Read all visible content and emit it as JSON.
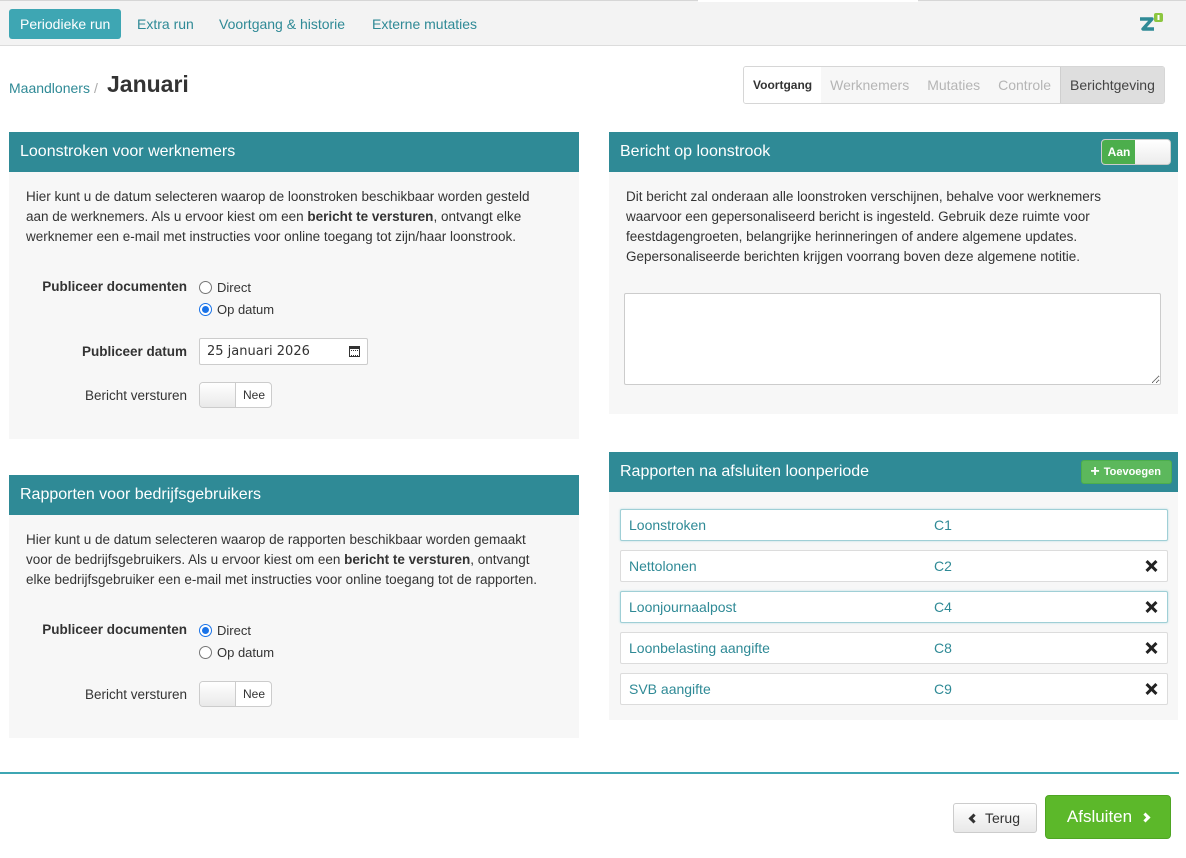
{
  "topnav": {
    "tabs": [
      "Periodieke run",
      "Extra run",
      "Voortgang & historie",
      "Externe mutaties"
    ]
  },
  "header": {
    "breadcrumb": "Maandloners",
    "breadcrumb_sep": "/",
    "title": "Januari"
  },
  "steps": [
    "Voortgang",
    "Werknemers",
    "Mutaties",
    "Controle",
    "Berichtgeving"
  ],
  "payslips_panel": {
    "title": "Loonstroken voor werknemers",
    "intro_1": "Hier kunt u de datum selecteren waarop de loonstroken beschikbaar worden gesteld",
    "intro_2a": "aan de werknemers. Als u ervoor kiest om een ",
    "intro_2b": "bericht te versturen",
    "intro_2c": ", ontvangt elke",
    "intro_3": "werknemer een e-mail met instructies voor online toegang tot zijn/haar loonstrook.",
    "publish_label": "Publiceer documenten",
    "opt_direct": "Direct",
    "opt_date": "Op datum",
    "date_label": "Publiceer datum",
    "date_value": "25 januari 2026",
    "send_label": "Bericht versturen",
    "send_toggle": "Nee"
  },
  "reports_users_panel": {
    "title": "Rapporten voor bedrijfsgebruikers",
    "intro_1": "Hier kunt u de datum selecteren waarop de rapporten beschikbaar worden gemaakt",
    "intro_2a": "voor de bedrijfsgebruikers. Als u ervoor kiest om een ",
    "intro_2b": "bericht te versturen",
    "intro_2c": ", ontvangt",
    "intro_3": "elke bedrijfsgebruiker een e-mail met instructies voor online toegang tot de rapporten.",
    "publish_label": "Publiceer documenten",
    "opt_direct": "Direct",
    "opt_date": "Op datum",
    "send_label": "Bericht versturen",
    "send_toggle": "Nee"
  },
  "message_panel": {
    "title": "Bericht op loonstrook",
    "toggle": "Aan",
    "text_1": "Dit bericht zal onderaan alle loonstroken verschijnen, behalve voor werknemers",
    "text_2": "waarvoor een gepersonaliseerd bericht is ingesteld. Gebruik deze ruimte voor",
    "text_3": "feestdagengroeten, belangrijke herinneringen of andere algemene updates.",
    "text_4": "Gepersonaliseerde berichten krijgen voorrang boven deze algemene notitie.",
    "textarea_value": ""
  },
  "reports_after_panel": {
    "title": "Rapporten na afsluiten loonperiode",
    "add_label": "Toevoegen",
    "rows": [
      {
        "name": "Loonstroken",
        "code": "C1"
      },
      {
        "name": "Nettolonen",
        "code": "C2"
      },
      {
        "name": "Loonjournaalpost",
        "code": "C4"
      },
      {
        "name": "Loonbelasting aangifte",
        "code": "C8"
      },
      {
        "name": "SVB aangifte",
        "code": "C9"
      }
    ]
  },
  "footer": {
    "back_label": "Terug",
    "finish_label": "Afsluiten"
  },
  "colors": {
    "teal": "#2f8a96",
    "teal_active": "#3ea6b3",
    "green": "#5cb82a"
  }
}
